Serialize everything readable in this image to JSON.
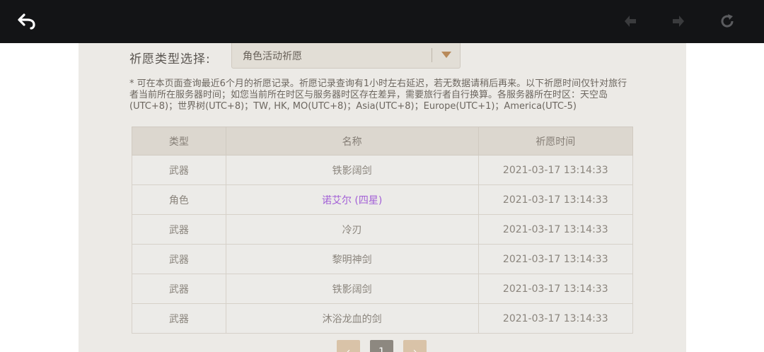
{
  "toolbar": {
    "back_icon": "back-arrow-icon",
    "prev_icon": "previous-icon",
    "next_icon": "next-icon",
    "refresh_icon": "refresh-icon"
  },
  "filter": {
    "label": "祈愿类型选择:",
    "selected": "角色活动祈愿"
  },
  "notice": "* 可在本页面查询最近6个月的祈愿记录。祈愿记录查询有1小时左右延迟，若无数据请稍后再来。以下祈愿时间仅针对旅行者当前所在服务器时间；如您当前所在时区与服务器时区存在差异，需要旅行者自行换算。各服务器所在时区：天空岛(UTC+8)；世界树(UTC+8)；TW, HK, MO(UTC+8)；Asia(UTC+8)；Europe(UTC+1)；America(UTC-5)",
  "table": {
    "headers": [
      "类型",
      "名称",
      "祈愿时间"
    ],
    "rows": [
      {
        "type": "武器",
        "name": "铁影阔剑",
        "time": "2021-03-17 13:14:33"
      },
      {
        "type": "角色",
        "name": "诺艾尔 (四星)",
        "time": "2021-03-17 13:14:33"
      },
      {
        "type": "武器",
        "name": "冷刃",
        "time": "2021-03-17 13:14:33"
      },
      {
        "type": "武器",
        "name": "黎明神剑",
        "time": "2021-03-17 13:14:33"
      },
      {
        "type": "武器",
        "name": "铁影阔剑",
        "time": "2021-03-17 13:14:33"
      },
      {
        "type": "武器",
        "name": "沐浴龙血的剑",
        "time": "2021-03-17 13:14:33"
      }
    ]
  },
  "pagination": {
    "prev": "‹",
    "page": "1",
    "next": "›"
  },
  "colors": {
    "topbar": "#131416",
    "four_star": "#a25fd6",
    "accent": "#b88a5a"
  }
}
